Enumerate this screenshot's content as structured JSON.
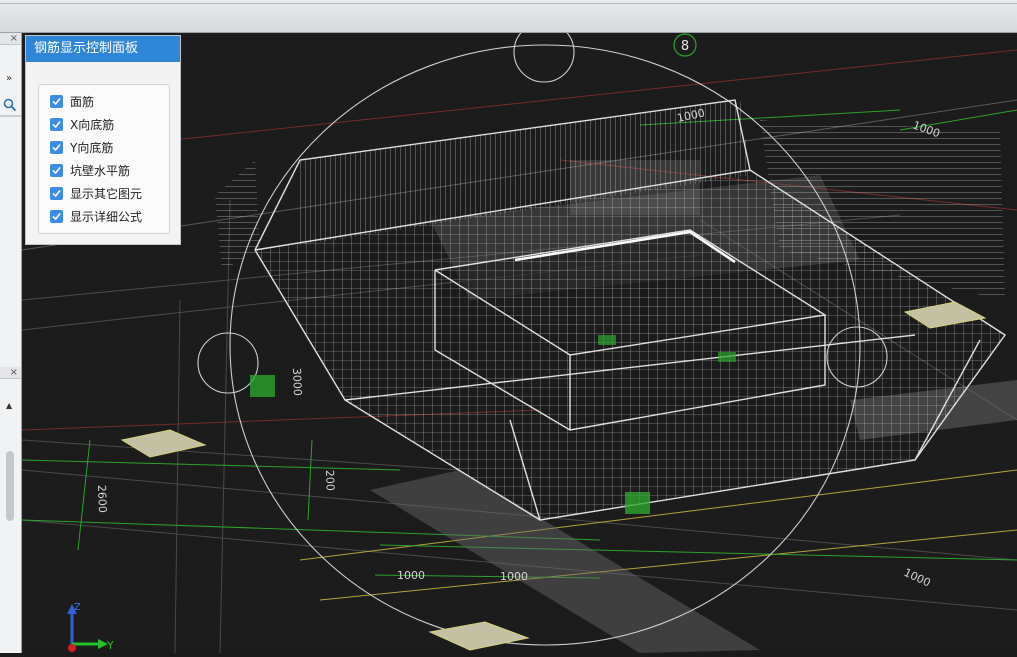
{
  "panel": {
    "title": "钢筋显示控制面板",
    "options": [
      {
        "label": "面筋",
        "checked": true
      },
      {
        "label": "X向底筋",
        "checked": true
      },
      {
        "label": "Y向底筋",
        "checked": true
      },
      {
        "label": "坑壁水平筋",
        "checked": true
      },
      {
        "label": "显示其它图元",
        "checked": true
      },
      {
        "label": "显示详细公式",
        "checked": true
      }
    ]
  },
  "left_strip": {
    "close_glyph": "×",
    "expand_glyph": "»",
    "search_icon": "search-icon",
    "scroll_up_glyph": "▲"
  },
  "viewport": {
    "axis_marker": "8",
    "dimensions": [
      "1000",
      "1000",
      "1000",
      "1000",
      "2600",
      "3000",
      "200",
      "1000"
    ],
    "axis_z_label": "Z",
    "axis_y_label": "Y"
  },
  "colors": {
    "panel_header": "#2f86d6",
    "checkbox": "#3a8ee6",
    "background": "#1c1c1c",
    "dim_green": "#2aa52a",
    "axis_red": "#8a2b2b"
  }
}
